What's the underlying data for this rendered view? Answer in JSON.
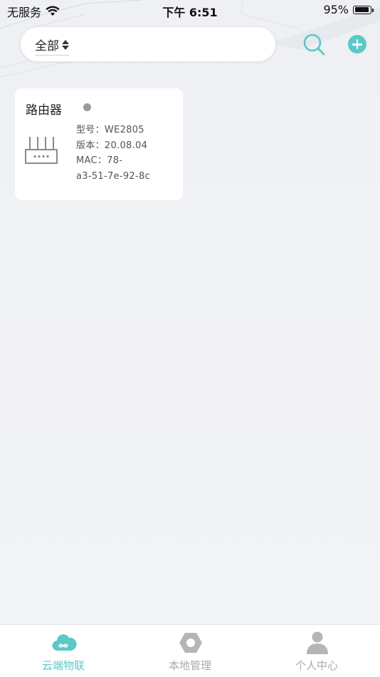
{
  "status_bar": {
    "carrier": "无服务",
    "time": "下午 6:51",
    "battery_percent": "95%",
    "battery_level": 0.95
  },
  "toolbar": {
    "filter_value": "全部",
    "search_icon": "search-icon",
    "add_icon": "add-icon"
  },
  "devices": [
    {
      "name": "路由器",
      "status_color": "#9a9a9a",
      "model_line": "型号：WE2805",
      "version_line": "版本：20.08.04",
      "mac_line_1": "MAC：78-",
      "mac_line_2": "a3-51-7e-92-8c"
    }
  ],
  "tabs": [
    {
      "label": "云端物联",
      "icon": "cloud-icon",
      "active": true
    },
    {
      "label": "本地管理",
      "icon": "hexagon-nut-icon",
      "active": false
    },
    {
      "label": "个人中心",
      "icon": "person-icon",
      "active": false
    }
  ],
  "colors": {
    "accent": "#5cc8c8",
    "inactive": "#aaaaaa"
  }
}
